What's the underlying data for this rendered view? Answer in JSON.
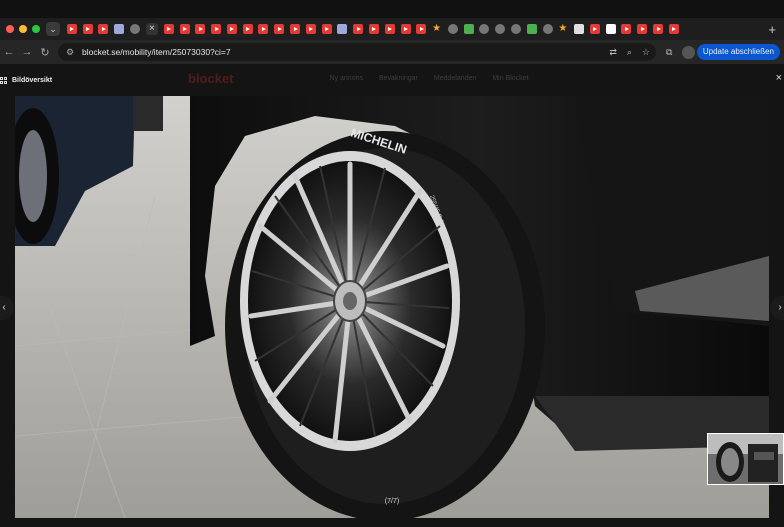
{
  "browser": {
    "traffic_lights": [
      "#ff5f57",
      "#febc2e",
      "#28c840"
    ],
    "url": "blocket.se/mobility/item/25073030?ci=7",
    "update_button": "Update abschließen",
    "tab_close": "×",
    "new_tab": "+"
  },
  "tabs": [
    {
      "icon": "youtube-icon",
      "color": "#e53935"
    },
    {
      "icon": "youtube-icon",
      "color": "#e53935"
    },
    {
      "icon": "youtube-icon",
      "color": "#e53935"
    },
    {
      "icon": "ae-icon",
      "color": "#9fa8da"
    },
    {
      "icon": "generic-site-icon",
      "color": "#777777"
    },
    {
      "icon": "youtube-icon",
      "color": "#e53935"
    },
    {
      "icon": "youtube-icon",
      "color": "#e53935"
    },
    {
      "icon": "youtube-icon",
      "color": "#e53935"
    },
    {
      "icon": "youtube-icon",
      "color": "#e53935"
    },
    {
      "icon": "youtube-icon",
      "color": "#e53935"
    },
    {
      "icon": "youtube-icon",
      "color": "#e53935"
    },
    {
      "icon": "youtube-icon",
      "color": "#e53935"
    },
    {
      "icon": "youtube-icon",
      "color": "#e53935"
    },
    {
      "icon": "youtube-icon",
      "color": "#e53935"
    },
    {
      "icon": "youtube-icon",
      "color": "#e53935"
    },
    {
      "icon": "youtube-icon",
      "color": "#e53935"
    },
    {
      "icon": "ae-icon",
      "color": "#9fa8da"
    },
    {
      "icon": "youtube-icon",
      "color": "#e53935"
    },
    {
      "icon": "youtube-icon",
      "color": "#e53935"
    },
    {
      "icon": "youtube-icon",
      "color": "#e53935"
    },
    {
      "icon": "youtube-icon",
      "color": "#e53935"
    },
    {
      "icon": "youtube-icon",
      "color": "#e53935"
    },
    {
      "icon": "star-icon",
      "color": "#f9a825"
    },
    {
      "icon": "globe-icon",
      "color": "#777777"
    },
    {
      "icon": "chrome-icon",
      "color": "#4caf50"
    },
    {
      "icon": "globe-icon",
      "color": "#777777"
    },
    {
      "icon": "globe-icon",
      "color": "#777777"
    },
    {
      "icon": "globe-icon",
      "color": "#777777"
    },
    {
      "icon": "chrome-icon",
      "color": "#4caf50"
    },
    {
      "icon": "globe-icon",
      "color": "#777777"
    },
    {
      "icon": "star-icon",
      "color": "#f9a825"
    },
    {
      "icon": "doc-icon",
      "color": "#e0e0e0"
    },
    {
      "icon": "youtube-icon",
      "color": "#e53935"
    },
    {
      "icon": "gmail-icon",
      "color": "#ffffff"
    },
    {
      "icon": "youtube-icon",
      "color": "#e53935"
    },
    {
      "icon": "youtube-icon",
      "color": "#e53935"
    },
    {
      "icon": "youtube-icon",
      "color": "#e53935"
    },
    {
      "icon": "youtube-icon",
      "color": "#e53935"
    }
  ],
  "page_header": {
    "logo": "blocket",
    "nav_items": [
      "Ny annons",
      "Bevakningar",
      "Meddelanden",
      "Min Blocket"
    ]
  },
  "viewer": {
    "overview_label": "Bildöversikt",
    "counter": "(7/7)",
    "close": "×",
    "prev": "‹",
    "next": "›",
    "tire_text": [
      "MICHELIN",
      "255/45 R 21"
    ]
  }
}
